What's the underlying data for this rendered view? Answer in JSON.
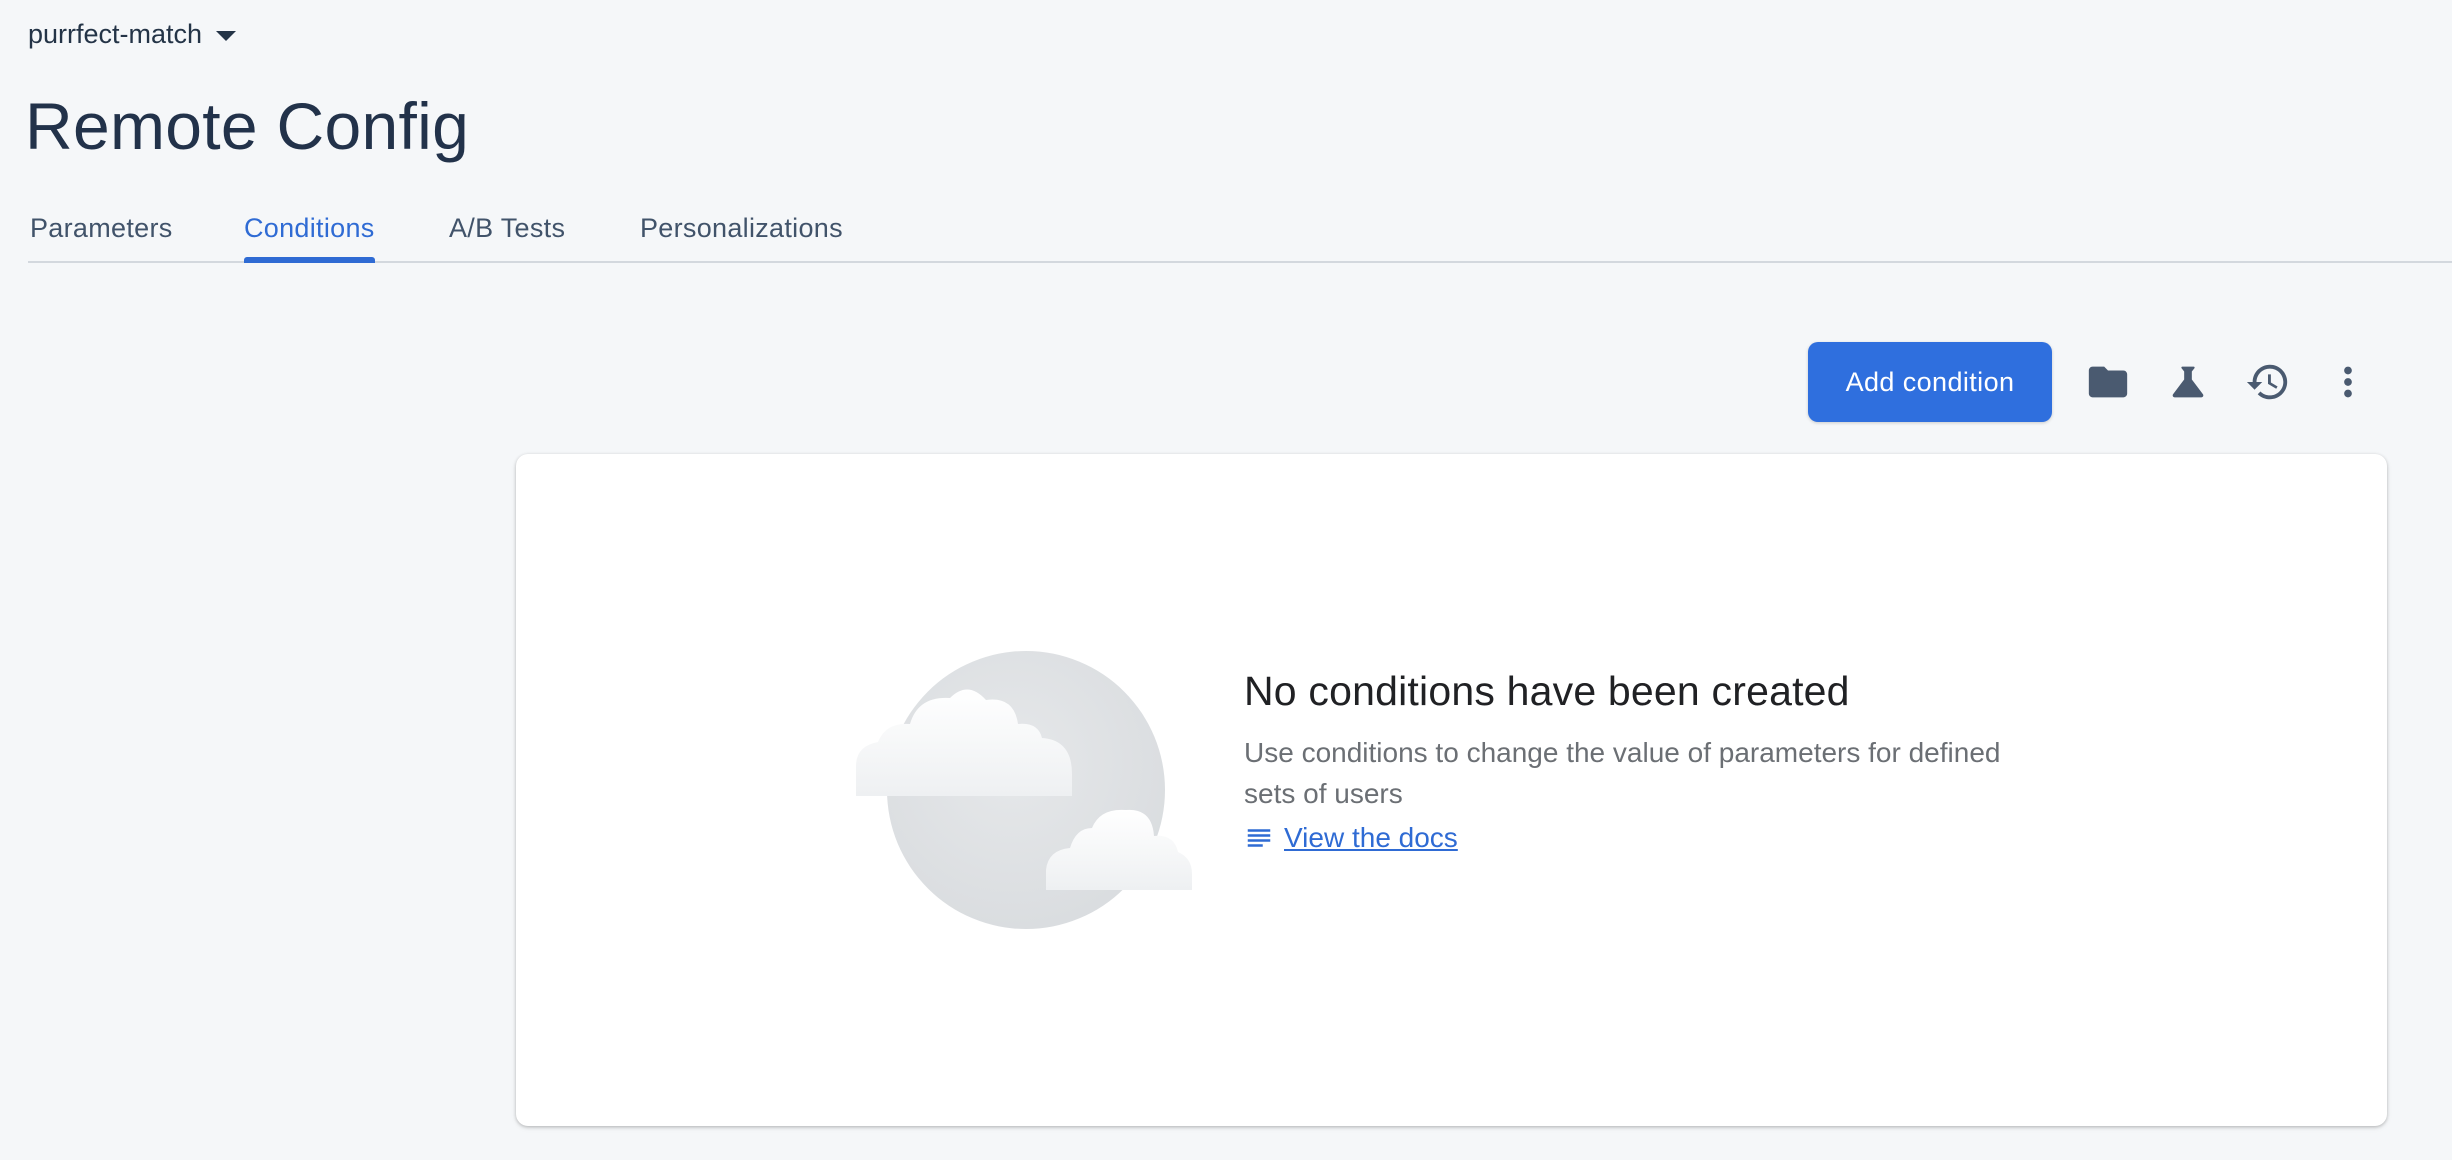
{
  "project": {
    "name": "purrfect-match",
    "dropdown_icon": "chevron-down-icon"
  },
  "page": {
    "title": "Remote Config"
  },
  "tabs": [
    {
      "label": "Parameters",
      "active": false
    },
    {
      "label": "Conditions",
      "active": true
    },
    {
      "label": "A/B Tests",
      "active": false
    },
    {
      "label": "Personalizations",
      "active": false
    }
  ],
  "toolbar": {
    "add_condition_label": "Add condition",
    "icons": [
      "folder-icon",
      "flask-icon",
      "history-icon",
      "more-vert-icon"
    ]
  },
  "empty_state": {
    "title": "No conditions have been created",
    "description": "Use conditions to change the value of parameters for defined sets of users",
    "docs_link": "View the docs",
    "docs_icon": "notes-icon",
    "illustration": "clouds-illustration"
  },
  "colors": {
    "accent": "#2f6bd4",
    "button": "#2f6fde",
    "background": "#f5f7f9",
    "card": "#ffffff",
    "icon": "#4a5a70"
  }
}
